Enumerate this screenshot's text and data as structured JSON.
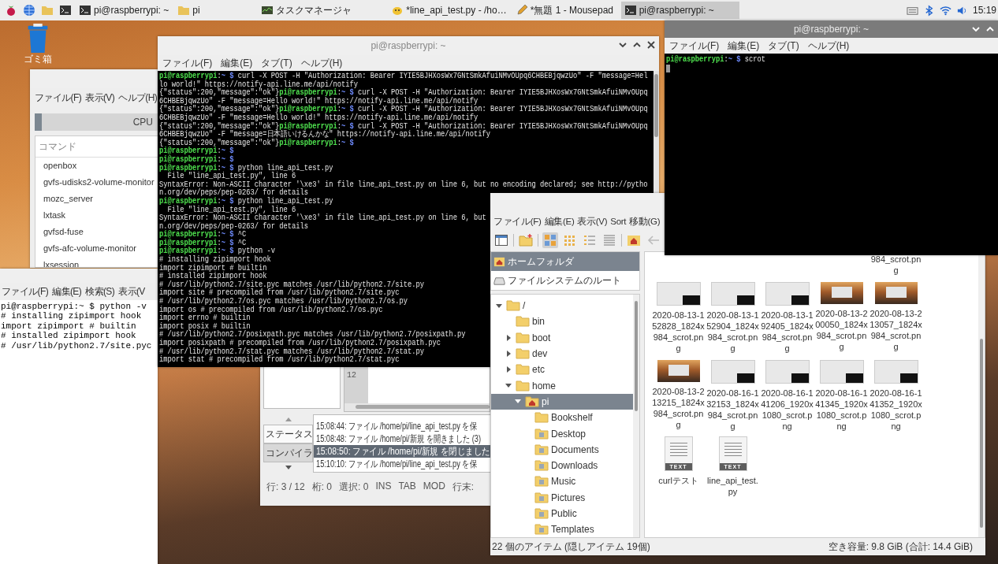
{
  "taskbar": {
    "tasks": [
      {
        "label": "pi@raspberrypi: ~",
        "kind": "terminal",
        "selected": false
      },
      {
        "label": "pi",
        "kind": "folder",
        "selected": false
      },
      {
        "label": "タスクマネージャ",
        "kind": "monitor",
        "selected": false
      },
      {
        "label": "*line_api_test.py - /ho…",
        "kind": "editor",
        "selected": false
      },
      {
        "label": "*無題 1 - Mousepad",
        "kind": "pen",
        "selected": false
      },
      {
        "label": "pi@raspberrypi: ~",
        "kind": "terminal",
        "selected": true
      }
    ],
    "clock": "15:19"
  },
  "desktop": {
    "trash_label": "ゴミ箱"
  },
  "task_manager": {
    "menu": [
      "ファイル(F)",
      "表示(V)",
      "ヘルプ(H)"
    ],
    "cpu_label": "CPU",
    "column": "コマンド",
    "processes": [
      "openbox",
      "gvfs-udisks2-volume-monitor",
      "mozc_server",
      "lxtask",
      "gvfsd-fuse",
      "gvfs-afc-volume-monitor",
      "lxsession"
    ]
  },
  "back_terminal": {
    "menu": [
      "ファイル(F)",
      "編集(E)",
      "検索(S)",
      "表示(V"
    ],
    "lines": [
      "pi@raspberrypi:~ $ python -v",
      "# installing zipimport hook",
      "import zipimport # builtin",
      "# installed zipimport hook",
      "# /usr/lib/python2.7/site.pyc"
    ]
  },
  "terminal": {
    "title": "pi@raspberrypi: ~",
    "menu": [
      "ファイル(F)",
      "編集(E)",
      "タブ(T)",
      "ヘルプ(H)"
    ],
    "lines": [
      {
        "user": "pi@raspberrypi",
        "sep": ":",
        "path": "~ $",
        "text": " curl -X POST -H \"Authorization: Bearer IYIE5BJHXosWx7GNtSmkAfuiNMvOUpq6CHBEBjqwzUo\" -F \"message=Hel"
      },
      {
        "text": "lo world!\" https://notify-api.line.me/api/notify"
      },
      {
        "pre": "{\"status\":200,\"message\":\"ok\"}",
        "user": "pi@raspberrypi",
        "sep": ":",
        "path": "~ $",
        "text": " curl -X POST -H \"Authorization: Bearer IYIE5BJHXosWx7GNtSmkAfuiNMvOUpq"
      },
      {
        "text": "6CHBEBjqwzUo\" -F \"message=Hello world!\" https://notify-api.line.me/api/notify"
      },
      {
        "pre": "{\"status\":200,\"message\":\"ok\"}",
        "user": "pi@raspberrypi",
        "sep": ":",
        "path": "~ $",
        "text": " curl -X POST -H \"Authorization: Bearer IYIE5BJHXosWx7GNtSmkAfuiNMvOUpq"
      },
      {
        "text": "6CHBEBjqwzUo\" -F \"message=Hello world!\" https://notify-api.line.me/api/notify"
      },
      {
        "pre": "{\"status\":200,\"message\":\"ok\"}",
        "user": "pi@raspberrypi",
        "sep": ":",
        "path": "~ $",
        "text": " curl -X POST -H \"Authorization: Bearer IYIE5BJHXosWx7GNtSmkAfuiNMvOUpq"
      },
      {
        "text": "6CHBEBjqwzUo\" -F \"message=日本語いけるんかな\" https://notify-api.line.me/api/notify"
      },
      {
        "pre": "{\"status\":200,\"message\":\"ok\"}",
        "user": "pi@raspberrypi",
        "sep": ":",
        "path": "~ $"
      },
      {
        "user": "pi@raspberrypi",
        "sep": ":",
        "path": "~ $"
      },
      {
        "user": "pi@raspberrypi",
        "sep": ":",
        "path": "~ $"
      },
      {
        "user": "pi@raspberrypi",
        "sep": ":",
        "path": "~ $",
        "text": " python line_api_test.py"
      },
      {
        "text": "  File \"line_api_test.py\", line 6"
      },
      {
        "text": "SyntaxError: Non-ASCII character '\\xe3' in file line_api_test.py on line 6, but no encoding declared; see http://pytho"
      },
      {
        "text": "n.org/dev/peps/pep-0263/ for details"
      },
      {
        "user": "pi@raspberrypi",
        "sep": ":",
        "path": "~ $",
        "text": " python line_api_test.py"
      },
      {
        "text": "  File \"line_api_test.py\", line 6"
      },
      {
        "text": "SyntaxError: Non-ASCII character '\\xe3' in file line_api_test.py on line 6, but"
      },
      {
        "text": "n.org/dev/peps/pep-0263/ for details"
      },
      {
        "user": "pi@raspberrypi",
        "sep": ":",
        "path": "~ $",
        "text": " ^C"
      },
      {
        "user": "pi@raspberrypi",
        "sep": ":",
        "path": "~ $",
        "text": " ^C"
      },
      {
        "user": "pi@raspberrypi",
        "sep": ":",
        "path": "~ $",
        "text": " python -v"
      },
      {
        "text": "# installing zipimport hook"
      },
      {
        "text": "import zipimport # builtin"
      },
      {
        "text": "# installed zipimport hook"
      },
      {
        "text": "# /usr/lib/python2.7/site.pyc matches /usr/lib/python2.7/site.py"
      },
      {
        "text": "import site # precompiled from /usr/lib/python2.7/site.pyc"
      },
      {
        "text": "# /usr/lib/python2.7/os.pyc matches /usr/lib/python2.7/os.py"
      },
      {
        "text": "import os # precompiled from /usr/lib/python2.7/os.pyc"
      },
      {
        "text": "import errno # builtin"
      },
      {
        "text": "import posix # builtin"
      },
      {
        "text": "# /usr/lib/python2.7/posixpath.pyc matches /usr/lib/python2.7/posixpath.py"
      },
      {
        "text": "import posixpath # precompiled from /usr/lib/python2.7/posixpath.pyc"
      },
      {
        "text": "# /usr/lib/python2.7/stat.pyc matches /usr/lib/python2.7/stat.py"
      },
      {
        "text": "import stat # precompiled from /usr/lib/python2.7/stat.pyc"
      }
    ]
  },
  "editor": {
    "line_number": "12",
    "tabs": [
      {
        "label": "ステータス",
        "selected": true
      },
      {
        "label": "コンパイラ",
        "selected": false
      }
    ],
    "log": [
      {
        "text": "15:08:44: ファイル /home/pi/line_api_test.py を保",
        "selected": false
      },
      {
        "text": "15:08:48: ファイル /home/pi/新規 を開きました (3)",
        "selected": false
      },
      {
        "text": "15:08:50: ファイル /home/pi/新規 を閉じました",
        "selected": true
      },
      {
        "text": "15:10:10: ファイル /home/pi/line_api_test.py を保",
        "selected": false
      }
    ],
    "status": [
      "行: 3 / 12",
      "桁: 0",
      "選択: 0",
      "INS",
      "TAB",
      "MOD",
      "行末:"
    ]
  },
  "file_manager": {
    "menu": [
      "ファイル(F)",
      "編集(E)",
      "表示(V)",
      "Sort",
      "移動(G)"
    ],
    "places": [
      {
        "label": "ホームフォルダ",
        "selected": true
      },
      {
        "label": "ファイルシステムのルート",
        "selected": false
      }
    ],
    "tree": [
      {
        "label": "/",
        "kind": "folder",
        "expanded": true,
        "selected": false,
        "children": [
          {
            "label": "bin",
            "kind": "folder",
            "selected": false
          },
          {
            "label": "boot",
            "kind": "folder",
            "expanded": false,
            "selected": false
          },
          {
            "label": "dev",
            "kind": "folder",
            "expanded": false,
            "selected": false
          },
          {
            "label": "etc",
            "kind": "folder",
            "expanded": false,
            "selected": false
          },
          {
            "label": "home",
            "kind": "folder",
            "expanded": true,
            "selected": false,
            "children": [
              {
                "label": "pi",
                "kind": "home",
                "expanded": true,
                "selected": true,
                "children": [
                  {
                    "label": "Bookshelf",
                    "kind": "folder",
                    "selected": false
                  },
                  {
                    "label": "Desktop",
                    "kind": "special",
                    "selected": false
                  },
                  {
                    "label": "Documents",
                    "kind": "special",
                    "selected": false
                  },
                  {
                    "label": "Downloads",
                    "kind": "special",
                    "selected": false
                  },
                  {
                    "label": "Music",
                    "kind": "special",
                    "selected": false
                  },
                  {
                    "label": "Pictures",
                    "kind": "special",
                    "selected": false
                  },
                  {
                    "label": "Public",
                    "kind": "special",
                    "selected": false
                  },
                  {
                    "label": "Templates",
                    "kind": "special",
                    "selected": false
                  }
                ]
              }
            ]
          }
        ]
      }
    ],
    "cut_item": "984_scrot.png",
    "files": [
      {
        "name": "2020-08-13-152828_1824x984_scrot.png",
        "kind": "screenshot"
      },
      {
        "name": "2020-08-13-152904_1824x984_scrot.png",
        "kind": "screenshot"
      },
      {
        "name": "2020-08-13-192405_1824x984_scrot.png",
        "kind": "screenshot"
      },
      {
        "name": "2020-08-13-200050_1824x984_scrot.png",
        "kind": "sunset"
      },
      {
        "name": "2020-08-13-213057_1824x984_scrot.png",
        "kind": "sunset"
      },
      {
        "name": "2020-08-13-213215_1824x984_scrot.png",
        "kind": "sunset"
      },
      {
        "name": "2020-08-16-132153_1824x984_scrot.png",
        "kind": "screenshot"
      },
      {
        "name": "2020-08-16-141206_1920x1080_scrot.png",
        "kind": "screenshot"
      },
      {
        "name": "2020-08-16-141345_1920x1080_scrot.png",
        "kind": "screenshot"
      },
      {
        "name": "2020-08-16-141352_1920x1080_scrot.png",
        "kind": "screenshot"
      },
      {
        "name": "curlテスト",
        "kind": "text",
        "badge": "TEXT"
      },
      {
        "name": "line_api_test.py",
        "kind": "text",
        "badge": "TEXT"
      }
    ],
    "status_left": "22 個のアイテム (隠しアイテム 19個)",
    "status_right": "空き容量: 9.8 GiB (合計: 14.4 GiB)"
  },
  "front_terminal": {
    "title": "pi@raspberrypi: ~",
    "menu": [
      "ファイル(F)",
      "編集(E)",
      "タブ(T)",
      "ヘルプ(H)"
    ],
    "lines": [
      {
        "user": "pi@raspberrypi",
        "sep": ":",
        "path": "~ $",
        "text": " scrot"
      }
    ]
  }
}
